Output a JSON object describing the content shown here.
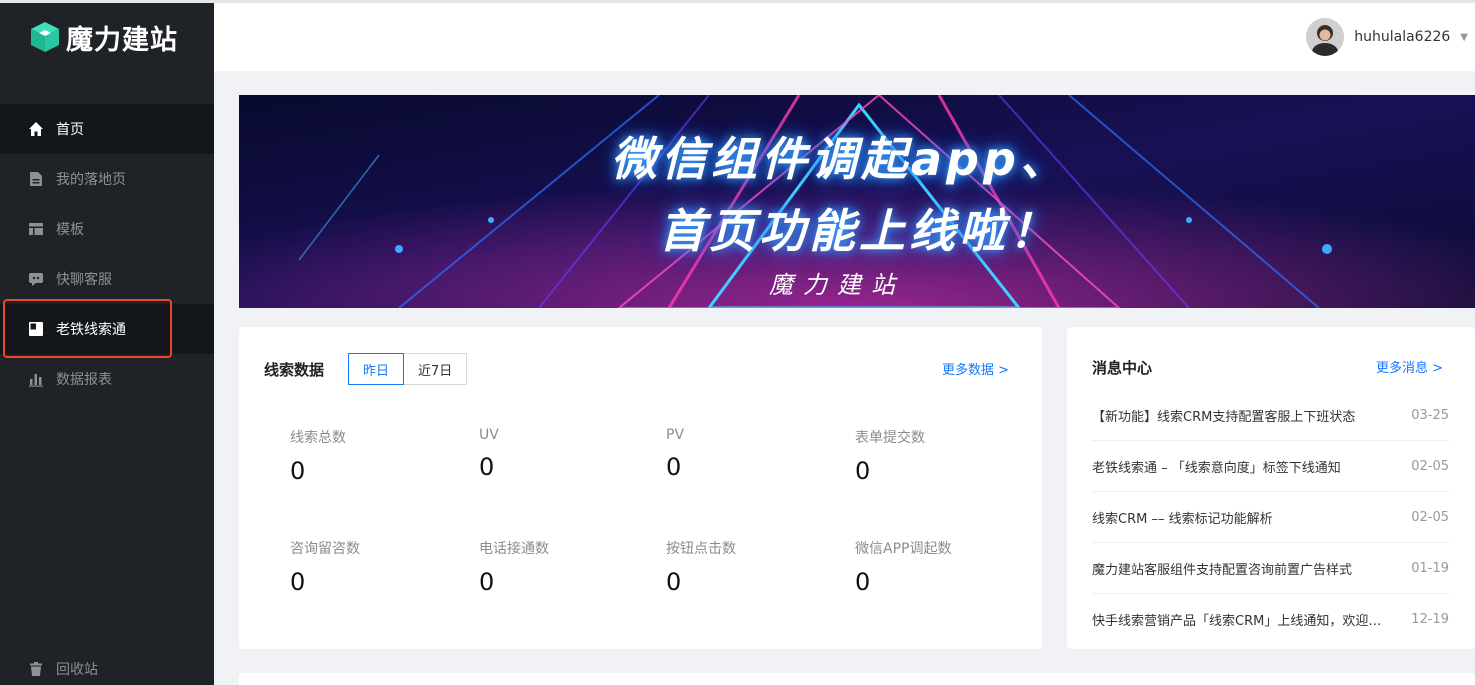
{
  "app": {
    "logo_text": "魔力建站"
  },
  "sidebar": {
    "items": [
      {
        "label": "首页",
        "icon": "home-icon"
      },
      {
        "label": "我的落地页",
        "icon": "file-icon"
      },
      {
        "label": "模板",
        "icon": "template-icon"
      },
      {
        "label": "快聊客服",
        "icon": "chat-icon"
      },
      {
        "label": "老铁线索通",
        "icon": "leads-icon"
      },
      {
        "label": "数据报表",
        "icon": "bar-chart-icon"
      }
    ],
    "recycle": {
      "label": "回收站",
      "icon": "trash-icon"
    }
  },
  "header": {
    "username": "huhulala6226"
  },
  "banner": {
    "line1": "微信组件调起app、",
    "line2": "首页功能上线啦！",
    "sub": "魔力建站"
  },
  "leads": {
    "title": "线索数据",
    "tabs": [
      "昨日",
      "近7日"
    ],
    "more": "更多数据 >",
    "stats": [
      {
        "label": "线索总数",
        "value": "0"
      },
      {
        "label": "UV",
        "value": "0"
      },
      {
        "label": "PV",
        "value": "0"
      },
      {
        "label": "表单提交数",
        "value": "0"
      },
      {
        "label": "咨询留咨数",
        "value": "0"
      },
      {
        "label": "电话接通数",
        "value": "0"
      },
      {
        "label": "按钮点击数",
        "value": "0"
      },
      {
        "label": "微信APP调起数",
        "value": "0"
      }
    ]
  },
  "messages": {
    "title": "消息中心",
    "more": "更多消息 >",
    "items": [
      {
        "text": "【新功能】线索CRM支持配置客服上下班状态",
        "date": "03-25"
      },
      {
        "text": "老铁线索通 – 「线索意向度」标签下线通知",
        "date": "02-05"
      },
      {
        "text": "线索CRM –– 线索标记功能解析",
        "date": "02-05"
      },
      {
        "text": "魔力建站客服组件支持配置咨询前置广告样式",
        "date": "01-19"
      },
      {
        "text": "快手线索营销产品「线索CRM」上线通知，欢迎体验",
        "date": "12-19"
      }
    ]
  },
  "colors": {
    "accent": "#1677ff",
    "sidebar": "#1f2226",
    "highlight": "#e8492c"
  }
}
